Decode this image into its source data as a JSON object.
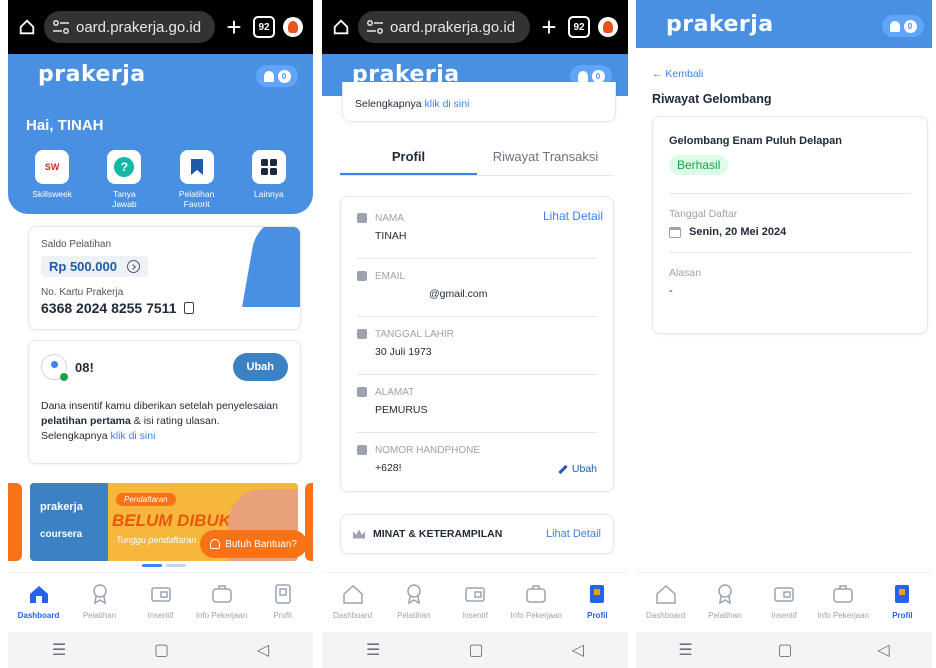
{
  "browser": {
    "url": "oard.prakerja.go.id",
    "tab_count": "92"
  },
  "app": {
    "logo": "prakerja",
    "notif_count": "0"
  },
  "dashboard": {
    "greeting": "Hai, TINAH",
    "quick_menu": [
      {
        "label": "Skillsweek"
      },
      {
        "label": "Tanya\nJawab"
      },
      {
        "label": "Pelatihan\nFavorit"
      },
      {
        "label": "Lainnya"
      }
    ],
    "saldo_label": "Saldo Pelatihan",
    "saldo_value": "Rp 500.000",
    "card_label": "No. Kartu Prakerja",
    "card_number": "6368 2024 8255 7511",
    "phone_partial": "08!",
    "ubah_label": "Ubah",
    "info_text_1": "Dana insentif kamu diberikan setelah penyelesaian",
    "info_bold": "pelatihan pertama",
    "info_text_2": " & isi rating ulasan.",
    "info_more": "Selengkapnya ",
    "info_link": "klik di sini",
    "banner_logo": "prakerja",
    "banner_partner": "coursera",
    "banner_tag": "Pendaftaran",
    "banner_headline": "BELUM DIBUKA",
    "banner_sub": "Tunggu pendaftaran",
    "help_label": "Butuh Bantuan?"
  },
  "nav": [
    {
      "label": "Dashboard"
    },
    {
      "label": "Pelatihan"
    },
    {
      "label": "Insentif"
    },
    {
      "label": "Info Pekerjaan"
    },
    {
      "label": "Profil"
    }
  ],
  "profile": {
    "top_more": "Selengkapnya ",
    "top_link": "klik di sini",
    "tab_profile": "Profil",
    "tab_history": "Riwayat Transaksi",
    "detail_link": "Lihat Detail",
    "fields": [
      {
        "label": "NAMA",
        "value": "TINAH"
      },
      {
        "label": "EMAIL",
        "value": "@gmail.com"
      },
      {
        "label": "TANGGAL LAHIR",
        "value": "30 Juli 1973"
      },
      {
        "label": "ALAMAT",
        "value": "PEMURUS"
      },
      {
        "label": "NOMOR HANDPHONE",
        "value": "+628!"
      }
    ],
    "ubah_label": "Ubah",
    "interest_title": "MINAT & KETERAMPILAN",
    "interest_link": "Lihat Detail"
  },
  "history": {
    "back_label": "← Kembali",
    "title": "Riwayat Gelombang",
    "wave_name": "Gelombang Enam Puluh Delapan",
    "status": "Berhasil",
    "reg_label": "Tanggal Daftar",
    "reg_date": "Senin, 20 Mei 2024",
    "reason_label": "Alasan",
    "reason_value": "-"
  },
  "colors": {
    "primary": "#4a90e2",
    "accent": "#f97316",
    "success": "#16a34a"
  }
}
